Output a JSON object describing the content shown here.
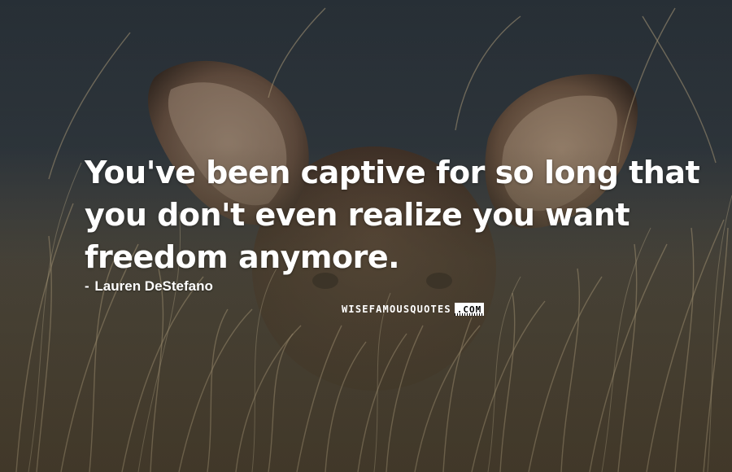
{
  "quote": {
    "lines": [
      "You've been captive for so long that",
      "you don't even realize you want",
      "freedom anymore."
    ]
  },
  "author": {
    "dash": "-",
    "name": "Lauren DeStefano"
  },
  "watermark": {
    "text": "WISEFAMOUSQUOTES",
    "suffix": ".COM"
  },
  "background": {
    "sky_color": "#39434b",
    "grass_color": "#7a6a4a",
    "deer_color": "#5a4233",
    "ear_inner_color": "#b89a7f"
  }
}
